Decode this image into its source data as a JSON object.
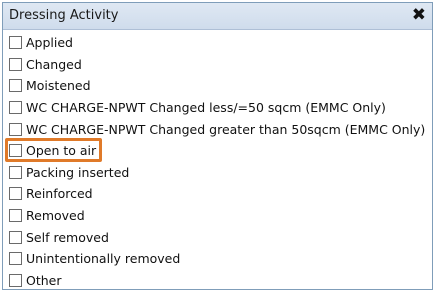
{
  "dialog": {
    "title": "Dressing Activity",
    "close_glyph": "✖"
  },
  "highlight_color": "#e07a29",
  "options": [
    {
      "label": "Applied",
      "checked": false
    },
    {
      "label": "Changed",
      "checked": false
    },
    {
      "label": "Moistened",
      "checked": false
    },
    {
      "label": "WC CHARGE-NPWT Changed less/=50 sqcm (EMMC Only)",
      "checked": false
    },
    {
      "label": "WC CHARGE-NPWT Changed greater than 50sqcm (EMMC Only)",
      "checked": false
    },
    {
      "label": "Open to air",
      "checked": false
    },
    {
      "label": "Packing inserted",
      "checked": false
    },
    {
      "label": "Reinforced",
      "checked": false
    },
    {
      "label": "Removed",
      "checked": false
    },
    {
      "label": "Self removed",
      "checked": false
    },
    {
      "label": "Unintentionally removed",
      "checked": false
    },
    {
      "label": "Other",
      "checked": false
    }
  ]
}
